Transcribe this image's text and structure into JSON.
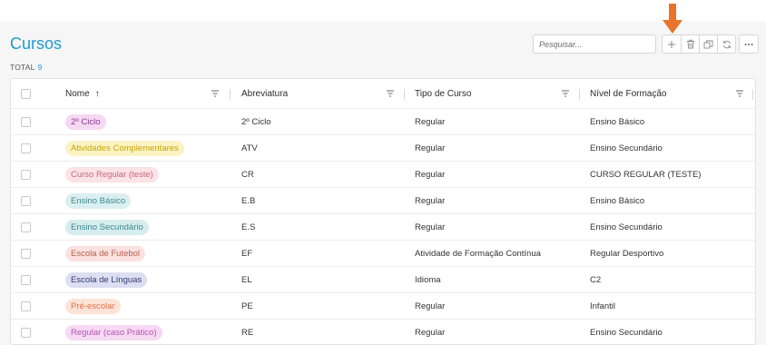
{
  "page": {
    "title": "Cursos",
    "total_label": "TOTAL",
    "total_count": "9"
  },
  "search": {
    "placeholder": "Pesquisar..."
  },
  "toolbar": {
    "buttons": [
      "add-icon",
      "trash-icon",
      "copy-icon",
      "refresh-icon",
      "more-icon"
    ],
    "more_label": "···"
  },
  "annotation": {
    "arrow_color": "#e8742b"
  },
  "table": {
    "columns": [
      {
        "label": "Nome",
        "sort_indicator": "↑"
      },
      {
        "label": "Abreviatura"
      },
      {
        "label": "Tipo de Curso"
      },
      {
        "label": "Nível de Formação"
      }
    ],
    "rows": [
      {
        "nome": "2º Ciclo",
        "tag_bg": "#f6d8f3",
        "tag_fg": "#8a3b89",
        "abrev": "2º Ciclo",
        "tipo": "Regular",
        "nivel": "Ensino Básico"
      },
      {
        "nome": "Atividades Complementares",
        "tag_bg": "#fbf3c4",
        "tag_fg": "#c7a700",
        "abrev": "ATV",
        "tipo": "Regular",
        "nivel": "Ensino Secundário"
      },
      {
        "nome": "Curso Regular (teste)",
        "tag_bg": "#fbe3e7",
        "tag_fg": "#c06a78",
        "abrev": "CR",
        "tipo": "Regular",
        "nivel": "CURSO REGULAR (TESTE)"
      },
      {
        "nome": "Ensino Básico",
        "tag_bg": "#dceff0",
        "tag_fg": "#3a8a91",
        "abrev": "E.B",
        "tipo": "Regular",
        "nivel": "Ensino Básico"
      },
      {
        "nome": "Ensino Secundário",
        "tag_bg": "#d7ecef",
        "tag_fg": "#3a8a91",
        "abrev": "E.S",
        "tipo": "Regular",
        "nivel": "Ensino Secundário"
      },
      {
        "nome": "Escola de Futebol",
        "tag_bg": "#fbe2e0",
        "tag_fg": "#b8604f",
        "abrev": "EF",
        "tipo": "Atividade de Formação Contínua",
        "nivel": "Regular Desportivo"
      },
      {
        "nome": "Escola de Línguas",
        "tag_bg": "#dcdff1",
        "tag_fg": "#2f3a75",
        "abrev": "EL",
        "tipo": "Idioma",
        "nivel": "C2"
      },
      {
        "nome": "Pré-escolar",
        "tag_bg": "#fde3d6",
        "tag_fg": "#e0734a",
        "abrev": "PE",
        "tipo": "Regular",
        "nivel": "Infantil"
      },
      {
        "nome": "Regular (caso Prático)",
        "tag_bg": "#f7d9f4",
        "tag_fg": "#b256b0",
        "abrev": "RE",
        "tipo": "Regular",
        "nivel": "Ensino Secundário"
      }
    ]
  }
}
